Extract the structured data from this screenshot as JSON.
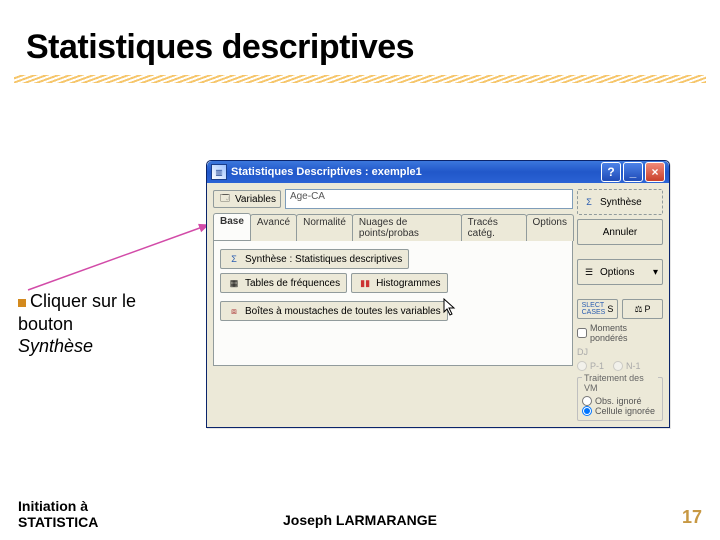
{
  "slide": {
    "title": "Statistiques descriptives",
    "instruction_prefix": "Cliquer sur le bouton ",
    "instruction_italic": "Synthèse"
  },
  "footer": {
    "left": "Initiation à\nSTATISTICA",
    "center": "Joseph LARMARANGE",
    "page": "17"
  },
  "dialog": {
    "title": "Statistiques Descriptives : exemple1",
    "variables_btn": "Variables",
    "variables_value": "Age-CA",
    "tabs": [
      "Base",
      "Avancé",
      "Normalité",
      "Nuages de points/probas",
      "Tracés catég.",
      "Options"
    ],
    "panel": {
      "synth": "Synthèse : Statistiques descriptives",
      "freq": "Tables de fréquences",
      "hist": "Histogrammes",
      "box": "Boîtes à moustaches de toutes les variables"
    },
    "right": {
      "synthese": "Synthèse",
      "annuler": "Annuler",
      "options": "Options",
      "s": "S",
      "p": "P",
      "moments": "Moments pondérés",
      "dj": "DJ",
      "p1": "P-1",
      "n1": "N-1",
      "vm_label": "Traitement des VM",
      "obs": "Obs. ignoré",
      "cell": "Cellule ignorée"
    }
  }
}
